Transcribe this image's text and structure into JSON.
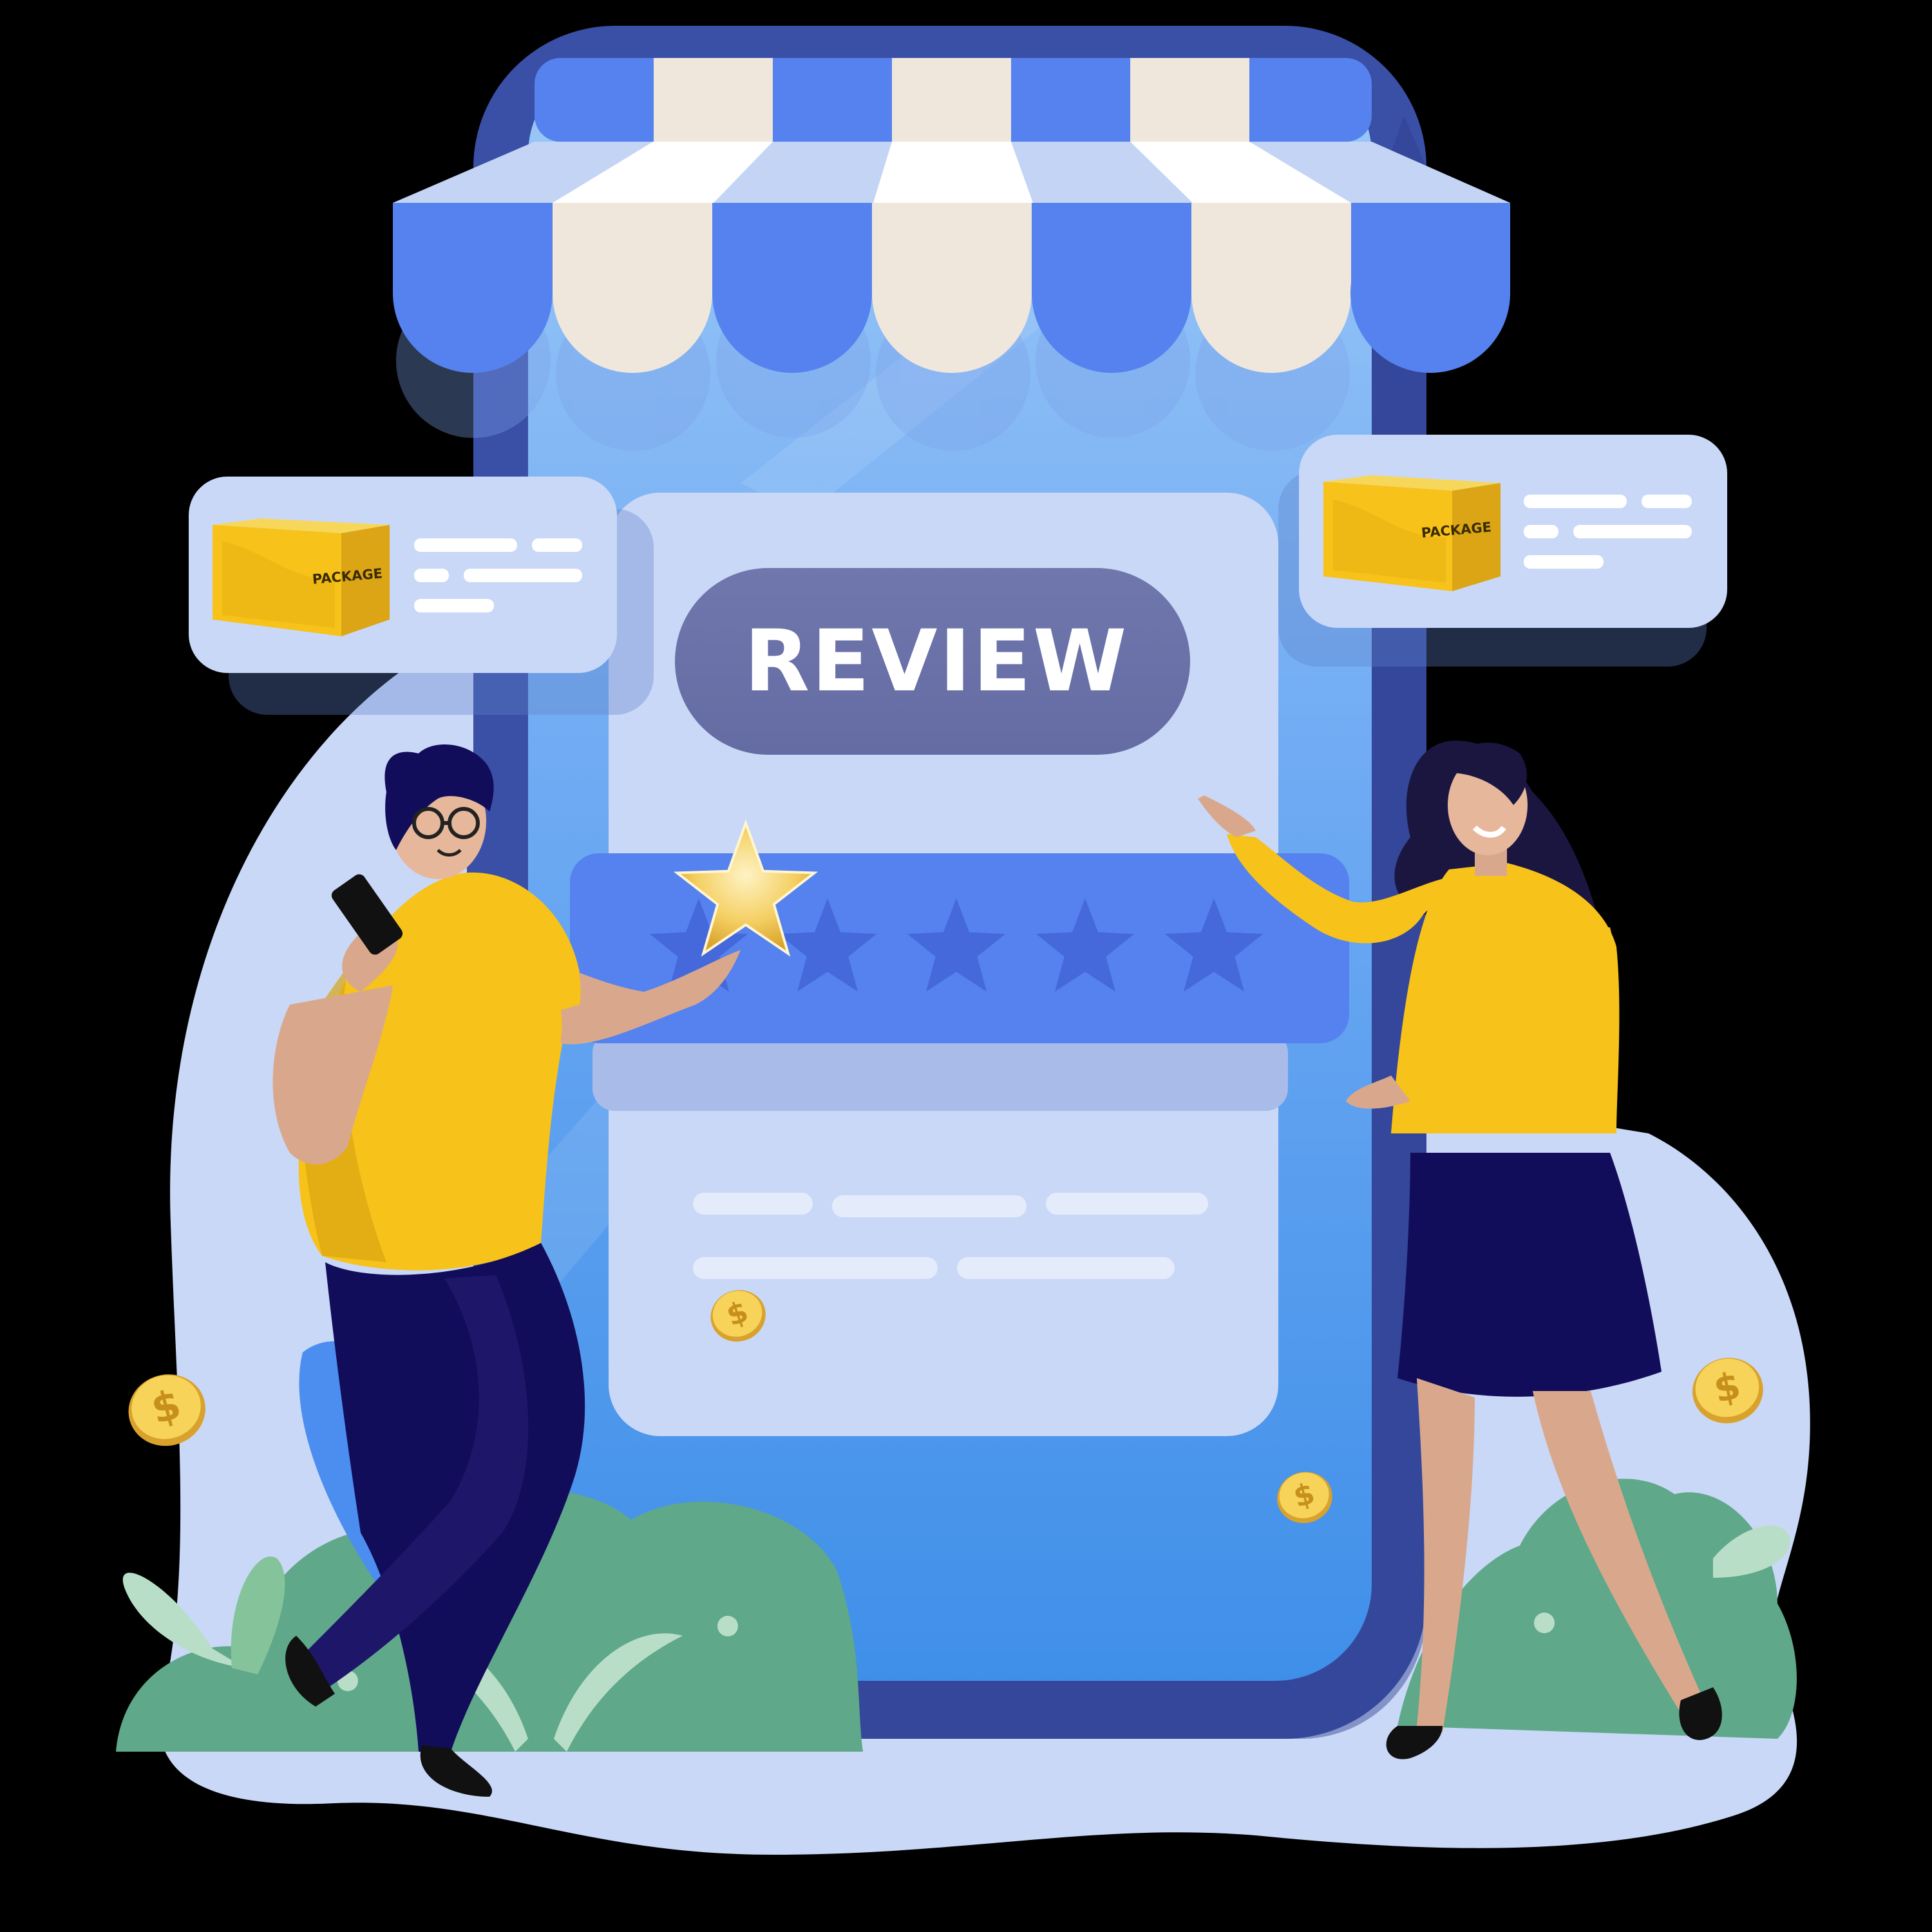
{
  "review_button": {
    "label": "REVIEW"
  },
  "rating": {
    "filled_stars": 1,
    "total_stars": 5
  },
  "package_cards": [
    {
      "label": "PACKAGE"
    },
    {
      "label": "PACKAGE"
    }
  ],
  "coins": {
    "symbol": "$"
  },
  "colors": {
    "background": "#000000",
    "blob": "#c9d8f7",
    "phone_frame": "#3a4fa6",
    "phone_screen": "#5fa0f0",
    "awning_blue": "#5582ee",
    "awning_cream": "#efe7dc",
    "review_pill": "#6b73a8",
    "star_bar": "#5582ee",
    "star_gold": "#f2c23c",
    "shirt_yellow": "#f7c21a",
    "pants_navy": "#120d5a",
    "plant_green": "#5fa88a",
    "coin_gold": "#f2c23c"
  },
  "icons": [
    "package-box-icon",
    "star-icon",
    "dollar-coin-icon",
    "smartphone-icon"
  ]
}
